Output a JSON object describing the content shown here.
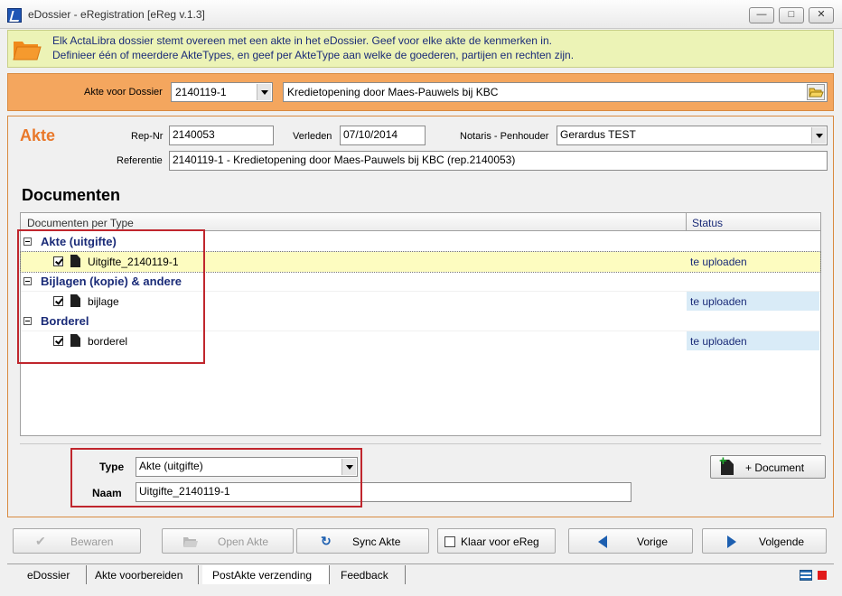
{
  "window": {
    "title": "eDossier - eRegistration [eReg v.1.3]",
    "controls": [
      "minimize",
      "maximize",
      "close"
    ]
  },
  "banner": {
    "line1": "Elk ActaLibra dossier stemt overeen met een akte in het eDossier. Geef voor elke akte de kenmerken in.",
    "line2": "Definieer één of meerdere AkteTypes, en geef per AkteType aan welke de goederen, partijen en rechten zijn."
  },
  "dossier": {
    "label": "Akte voor Dossier",
    "selected": "2140119-1",
    "description": "Kredietopening door Maes-Pauwels bij KBC"
  },
  "akte": {
    "title": "Akte",
    "repnr_label": "Rep-Nr",
    "repnr": "2140053",
    "verleden_label": "Verleden",
    "verleden": "07/10/2014",
    "notaris_label": "Notaris - Penhouder",
    "notaris": "Gerardus TEST",
    "referentie_label": "Referentie",
    "referentie": "2140119-1 - Kredietopening door Maes-Pauwels bij KBC (rep.2140053)"
  },
  "documents": {
    "title": "Documenten",
    "col_docs": "Documenten per Type",
    "col_status": "Status",
    "groups": [
      {
        "label": "Akte (uitgifte)",
        "doc": "Uitgifte_2140119-1",
        "status": "te uploaden",
        "selected": true
      },
      {
        "label": "Bijlagen (kopie) & andere",
        "doc": "bijlage",
        "status": "te uploaden",
        "selected": false
      },
      {
        "label": "Borderel",
        "doc": "borderel",
        "status": "te uploaden",
        "selected": false
      }
    ]
  },
  "editor": {
    "type_label": "Type",
    "type_value": "Akte (uitgifte)",
    "naam_label": "Naam",
    "naam_value": "Uitgifte_2140119-1",
    "add_label": "+  Document"
  },
  "actions": {
    "bewaren": "Bewaren",
    "open_akte": "Open Akte",
    "sync_akte": "Sync Akte",
    "klaar": "Klaar voor eReg",
    "vorige": "Vorige",
    "volgende": "Volgende"
  },
  "tabs": [
    "eDossier",
    "Akte voorbereiden",
    "PostAkte verzending",
    "Feedback"
  ],
  "active_tab": "PostAkte verzending",
  "colors": {
    "accent_orange": "#e9782a",
    "banner_yellow": "#ecf3b6",
    "strip_orange": "#f4a65e",
    "group_blue": "#1a2b78",
    "highlight_red": "#c0262d"
  }
}
